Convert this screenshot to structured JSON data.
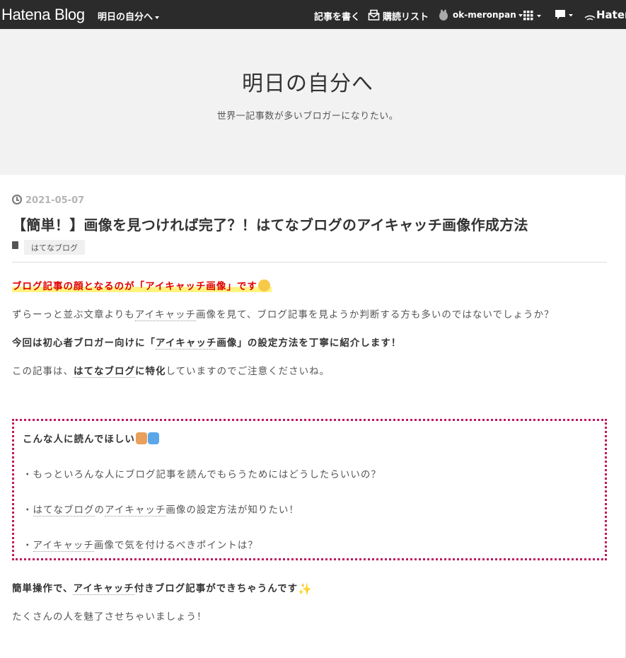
{
  "topbar": {
    "logo": "Hatena Blog",
    "blog_name": "明日の自分へ",
    "write": "記事を書く",
    "reading_list": "購読リスト",
    "user": "ok-meronpan",
    "brand_partial": "Hater"
  },
  "header": {
    "title": "明日の自分へ",
    "description": "世界一記事数が多いブロガーになりたい。"
  },
  "entry": {
    "date": "2021-05-07",
    "title": "【簡単！】画像を見つければ完了？！はてなブログのアイキャッチ画像作成方法",
    "category": "はてなブログ",
    "lead": "ブログ記事の顔となるのが「アイキャッチ画像」です",
    "p1_a": "ずらーっと並ぶ文章よりも",
    "p1_kw": "アイキャッチ",
    "p1_b": "画像を見て、ブログ記事を見ようか判断する方も多いのではないでしょうか？",
    "p2_a": "今回は初心者ブロガー向けに「",
    "p2_kw": "アイキャッチ",
    "p2_b": "画像」の設定方法を丁寧に紹介します！",
    "p3_a": "この記事は、",
    "p3_kw": "はてなブログ",
    "p3_b": "に特化",
    "p3_c": "していますのでご注意くださいね。",
    "box_title": "こんな人に読んでほしい",
    "box_item1": "・もっといろんな人にブログ記事を読んでもらうためにはどうしたらいいの？",
    "box_item2_a": "・",
    "box_item2_kw": "はてなブログ",
    "box_item2_b": "の",
    "box_item2_kw2": "アイキャッチ",
    "box_item2_c": "画像の設定方法が知りたい！",
    "box_item3_a": "・",
    "box_item3_kw": "アイキャッチ",
    "box_item3_b": "画像で気を付けるべきポイントは？",
    "p4_a": "簡単操作で、",
    "p4_kw": "アイキャッチ",
    "p4_b": "付きブログ記事ができちゃうんです",
    "p5": "たくさんの人を魅了させちゃいましょう！"
  },
  "colors": {
    "topbar_bg": "#2b2b2b",
    "lead_red": "#e00000",
    "box_border": "#c2185b",
    "highlight": "#fff380"
  }
}
